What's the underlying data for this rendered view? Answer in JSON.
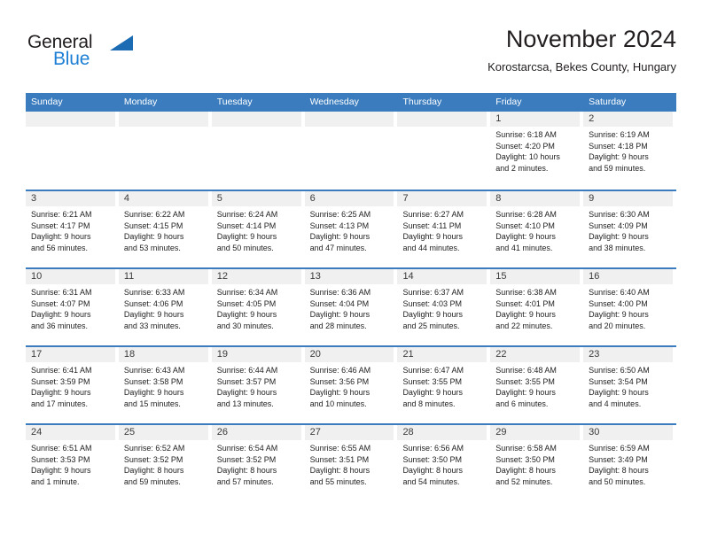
{
  "brand": {
    "name_top": "General",
    "name_bottom": "Blue"
  },
  "header": {
    "title": "November 2024",
    "subtitle": "Korostarcsa, Bekes County, Hungary"
  },
  "colors": {
    "header_blue": "#3a7cbe",
    "brand_blue": "#1c7fd4",
    "logo_triangle": "#1b6cb3",
    "day_band_gray": "#f0f0f0",
    "text_dark": "#231f20"
  },
  "weekdays": [
    "Sunday",
    "Monday",
    "Tuesday",
    "Wednesday",
    "Thursday",
    "Friday",
    "Saturday"
  ],
  "weeks": [
    [
      {
        "day": "",
        "empty": true,
        "sunrise": "",
        "sunset": "",
        "daylight_1": "",
        "daylight_2": ""
      },
      {
        "day": "",
        "empty": true,
        "sunrise": "",
        "sunset": "",
        "daylight_1": "",
        "daylight_2": ""
      },
      {
        "day": "",
        "empty": true,
        "sunrise": "",
        "sunset": "",
        "daylight_1": "",
        "daylight_2": ""
      },
      {
        "day": "",
        "empty": true,
        "sunrise": "",
        "sunset": "",
        "daylight_1": "",
        "daylight_2": ""
      },
      {
        "day": "",
        "empty": true,
        "sunrise": "",
        "sunset": "",
        "daylight_1": "",
        "daylight_2": ""
      },
      {
        "day": "1",
        "sunrise": "Sunrise: 6:18 AM",
        "sunset": "Sunset: 4:20 PM",
        "daylight_1": "Daylight: 10 hours",
        "daylight_2": "and 2 minutes."
      },
      {
        "day": "2",
        "sunrise": "Sunrise: 6:19 AM",
        "sunset": "Sunset: 4:18 PM",
        "daylight_1": "Daylight: 9 hours",
        "daylight_2": "and 59 minutes."
      }
    ],
    [
      {
        "day": "3",
        "sunrise": "Sunrise: 6:21 AM",
        "sunset": "Sunset: 4:17 PM",
        "daylight_1": "Daylight: 9 hours",
        "daylight_2": "and 56 minutes."
      },
      {
        "day": "4",
        "sunrise": "Sunrise: 6:22 AM",
        "sunset": "Sunset: 4:15 PM",
        "daylight_1": "Daylight: 9 hours",
        "daylight_2": "and 53 minutes."
      },
      {
        "day": "5",
        "sunrise": "Sunrise: 6:24 AM",
        "sunset": "Sunset: 4:14 PM",
        "daylight_1": "Daylight: 9 hours",
        "daylight_2": "and 50 minutes."
      },
      {
        "day": "6",
        "sunrise": "Sunrise: 6:25 AM",
        "sunset": "Sunset: 4:13 PM",
        "daylight_1": "Daylight: 9 hours",
        "daylight_2": "and 47 minutes."
      },
      {
        "day": "7",
        "sunrise": "Sunrise: 6:27 AM",
        "sunset": "Sunset: 4:11 PM",
        "daylight_1": "Daylight: 9 hours",
        "daylight_2": "and 44 minutes."
      },
      {
        "day": "8",
        "sunrise": "Sunrise: 6:28 AM",
        "sunset": "Sunset: 4:10 PM",
        "daylight_1": "Daylight: 9 hours",
        "daylight_2": "and 41 minutes."
      },
      {
        "day": "9",
        "sunrise": "Sunrise: 6:30 AM",
        "sunset": "Sunset: 4:09 PM",
        "daylight_1": "Daylight: 9 hours",
        "daylight_2": "and 38 minutes."
      }
    ],
    [
      {
        "day": "10",
        "sunrise": "Sunrise: 6:31 AM",
        "sunset": "Sunset: 4:07 PM",
        "daylight_1": "Daylight: 9 hours",
        "daylight_2": "and 36 minutes."
      },
      {
        "day": "11",
        "sunrise": "Sunrise: 6:33 AM",
        "sunset": "Sunset: 4:06 PM",
        "daylight_1": "Daylight: 9 hours",
        "daylight_2": "and 33 minutes."
      },
      {
        "day": "12",
        "sunrise": "Sunrise: 6:34 AM",
        "sunset": "Sunset: 4:05 PM",
        "daylight_1": "Daylight: 9 hours",
        "daylight_2": "and 30 minutes."
      },
      {
        "day": "13",
        "sunrise": "Sunrise: 6:36 AM",
        "sunset": "Sunset: 4:04 PM",
        "daylight_1": "Daylight: 9 hours",
        "daylight_2": "and 28 minutes."
      },
      {
        "day": "14",
        "sunrise": "Sunrise: 6:37 AM",
        "sunset": "Sunset: 4:03 PM",
        "daylight_1": "Daylight: 9 hours",
        "daylight_2": "and 25 minutes."
      },
      {
        "day": "15",
        "sunrise": "Sunrise: 6:38 AM",
        "sunset": "Sunset: 4:01 PM",
        "daylight_1": "Daylight: 9 hours",
        "daylight_2": "and 22 minutes."
      },
      {
        "day": "16",
        "sunrise": "Sunrise: 6:40 AM",
        "sunset": "Sunset: 4:00 PM",
        "daylight_1": "Daylight: 9 hours",
        "daylight_2": "and 20 minutes."
      }
    ],
    [
      {
        "day": "17",
        "sunrise": "Sunrise: 6:41 AM",
        "sunset": "Sunset: 3:59 PM",
        "daylight_1": "Daylight: 9 hours",
        "daylight_2": "and 17 minutes."
      },
      {
        "day": "18",
        "sunrise": "Sunrise: 6:43 AM",
        "sunset": "Sunset: 3:58 PM",
        "daylight_1": "Daylight: 9 hours",
        "daylight_2": "and 15 minutes."
      },
      {
        "day": "19",
        "sunrise": "Sunrise: 6:44 AM",
        "sunset": "Sunset: 3:57 PM",
        "daylight_1": "Daylight: 9 hours",
        "daylight_2": "and 13 minutes."
      },
      {
        "day": "20",
        "sunrise": "Sunrise: 6:46 AM",
        "sunset": "Sunset: 3:56 PM",
        "daylight_1": "Daylight: 9 hours",
        "daylight_2": "and 10 minutes."
      },
      {
        "day": "21",
        "sunrise": "Sunrise: 6:47 AM",
        "sunset": "Sunset: 3:55 PM",
        "daylight_1": "Daylight: 9 hours",
        "daylight_2": "and 8 minutes."
      },
      {
        "day": "22",
        "sunrise": "Sunrise: 6:48 AM",
        "sunset": "Sunset: 3:55 PM",
        "daylight_1": "Daylight: 9 hours",
        "daylight_2": "and 6 minutes."
      },
      {
        "day": "23",
        "sunrise": "Sunrise: 6:50 AM",
        "sunset": "Sunset: 3:54 PM",
        "daylight_1": "Daylight: 9 hours",
        "daylight_2": "and 4 minutes."
      }
    ],
    [
      {
        "day": "24",
        "sunrise": "Sunrise: 6:51 AM",
        "sunset": "Sunset: 3:53 PM",
        "daylight_1": "Daylight: 9 hours",
        "daylight_2": "and 1 minute."
      },
      {
        "day": "25",
        "sunrise": "Sunrise: 6:52 AM",
        "sunset": "Sunset: 3:52 PM",
        "daylight_1": "Daylight: 8 hours",
        "daylight_2": "and 59 minutes."
      },
      {
        "day": "26",
        "sunrise": "Sunrise: 6:54 AM",
        "sunset": "Sunset: 3:52 PM",
        "daylight_1": "Daylight: 8 hours",
        "daylight_2": "and 57 minutes."
      },
      {
        "day": "27",
        "sunrise": "Sunrise: 6:55 AM",
        "sunset": "Sunset: 3:51 PM",
        "daylight_1": "Daylight: 8 hours",
        "daylight_2": "and 55 minutes."
      },
      {
        "day": "28",
        "sunrise": "Sunrise: 6:56 AM",
        "sunset": "Sunset: 3:50 PM",
        "daylight_1": "Daylight: 8 hours",
        "daylight_2": "and 54 minutes."
      },
      {
        "day": "29",
        "sunrise": "Sunrise: 6:58 AM",
        "sunset": "Sunset: 3:50 PM",
        "daylight_1": "Daylight: 8 hours",
        "daylight_2": "and 52 minutes."
      },
      {
        "day": "30",
        "sunrise": "Sunrise: 6:59 AM",
        "sunset": "Sunset: 3:49 PM",
        "daylight_1": "Daylight: 8 hours",
        "daylight_2": "and 50 minutes."
      }
    ]
  ]
}
